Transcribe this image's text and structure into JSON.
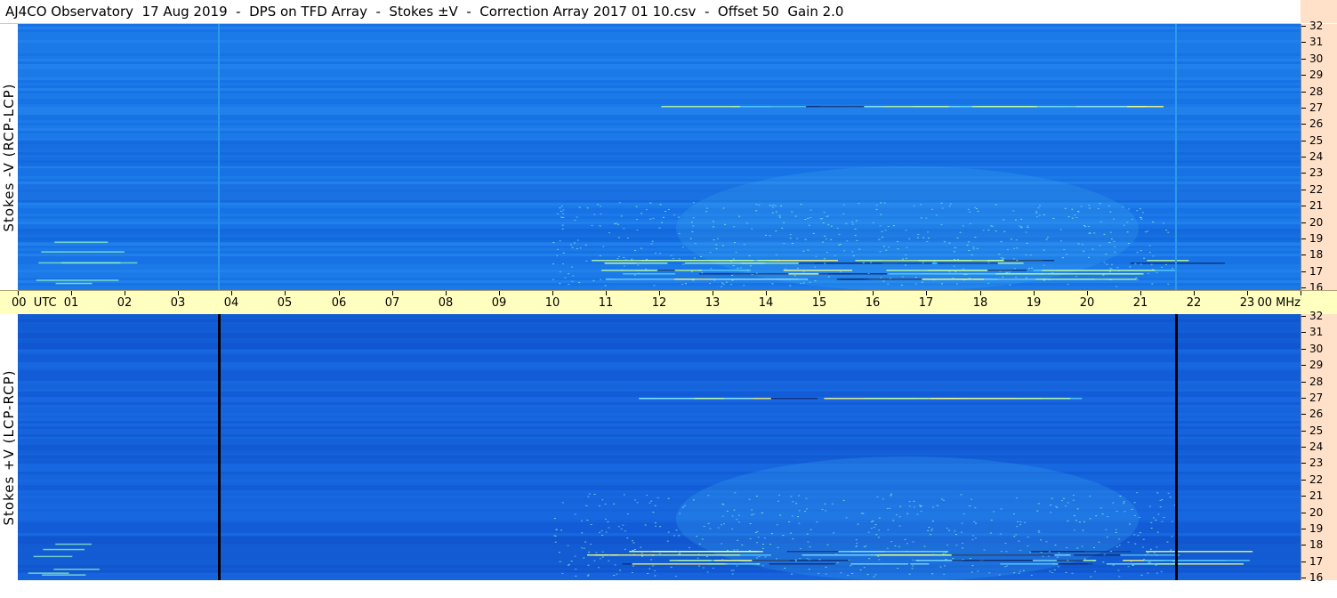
{
  "title": "AJ4CO Observatory  17 Aug 2019  -  DPS on TFD Array  -  Stokes ±V  -  Correction Array 2017 01 10.csv  -  Offset 50  Gain 2.0",
  "top_panel": {
    "ylabel": "Stokes -V (RCP-LCP)",
    "background_color": "#1a78e8",
    "marker_color": "#2a9be8"
  },
  "bottom_panel": {
    "ylabel": "Stokes +V (LCP-RCP)",
    "background_color": "#1462dc",
    "marker_color": "#000000"
  },
  "freq_axis": {
    "unit": "MHz",
    "labels": [
      "32",
      "31",
      "30",
      "29",
      "28",
      "27",
      "26",
      "25",
      "24",
      "23",
      "22",
      "21",
      "20",
      "19",
      "18",
      "17",
      "16"
    ]
  },
  "time_axis": {
    "labels": [
      "00  UTC",
      "01",
      "02",
      "03",
      "04",
      "05",
      "06",
      "07",
      "08",
      "09",
      "10",
      "11",
      "12",
      "13",
      "14",
      "15",
      "16",
      "17",
      "18",
      "19",
      "20",
      "21",
      "22",
      "23",
      "00"
    ],
    "unit": "MHz"
  },
  "colors": {
    "axis_band": "#ffffc0",
    "freq_band": "#ffe0c8"
  }
}
